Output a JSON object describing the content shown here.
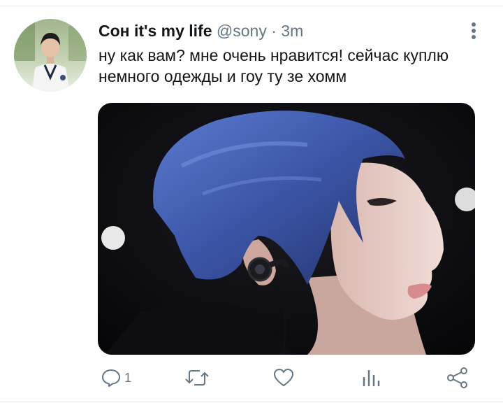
{
  "tweet": {
    "display_name": "Сон it's my life",
    "handle": "@sony",
    "separator": "·",
    "time": "3m",
    "text": "ну как вам? мне очень нравится! сейчас куплю немного одежды и гоу ту зе хомм",
    "avatar_icon": "avatar-photo",
    "media_icon": "photo-blue-hair-person",
    "more_icon": "more-vertical-icon"
  },
  "actions": {
    "reply": {
      "icon": "reply-icon",
      "count": "1"
    },
    "retweet": {
      "icon": "retweet-icon"
    },
    "like": {
      "icon": "heart-icon"
    },
    "analytics": {
      "icon": "analytics-icon"
    },
    "share": {
      "icon": "share-icon"
    }
  },
  "colors": {
    "text": "#14171a",
    "secondary": "#657786",
    "divider": "#e6ecf0",
    "hair": "#3c5aa8"
  }
}
